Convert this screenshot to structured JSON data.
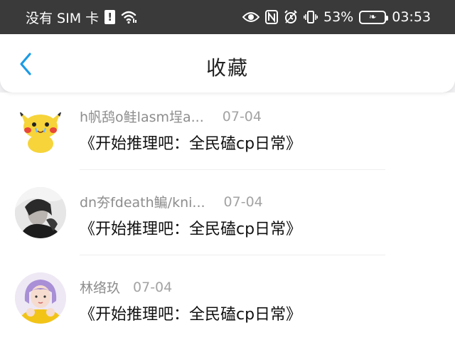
{
  "status_bar": {
    "carrier": "没有 SIM 卡",
    "battery_percent": "53%",
    "time": "03:53",
    "icons": [
      "sim-alert-icon",
      "wifi-icon",
      "eye-icon",
      "nfc-icon",
      "alarm-icon",
      "vibrate-icon",
      "battery-icon"
    ]
  },
  "header": {
    "title": "收藏",
    "back_icon": "chevron-left-icon",
    "accent_color": "#1a9be6"
  },
  "items": [
    {
      "name": "h帆鸹o鲑lasm埕a...",
      "date": "07-04",
      "title": "《开始推理吧：全民磕cp日常》",
      "avatar": "pikachu-avatar"
    },
    {
      "name": "dn夯fdeath鳊/kni...",
      "date": "07-04",
      "title": "《开始推理吧：全民磕cp日常》",
      "avatar": "dark-portrait-avatar"
    },
    {
      "name": "林络玖",
      "date": "07-04",
      "title": "《开始推理吧：全民磕cp日常》",
      "avatar": "purple-hair-avatar"
    }
  ]
}
